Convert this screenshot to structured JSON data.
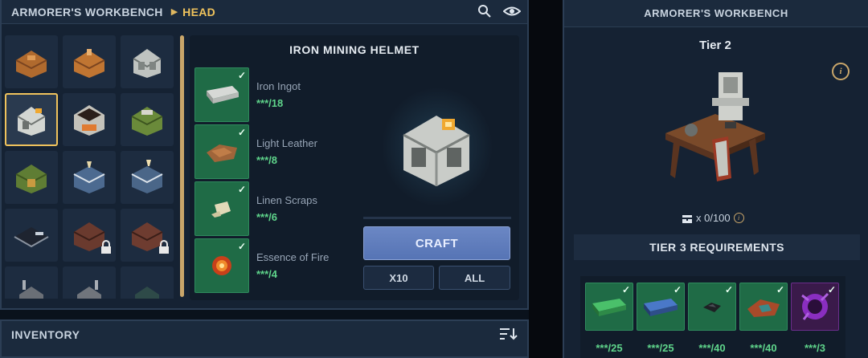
{
  "left": {
    "breadcrumb_root": "ARMORER'S WORKBENCH",
    "breadcrumb_current": "HEAD",
    "icons": [
      "search-icon",
      "eye-icon"
    ]
  },
  "recipe": {
    "title": "IRON MINING HELMET",
    "ingredients": [
      {
        "name": "Iron Ingot",
        "qty": "***/18",
        "icon": "iron-ingot-icon"
      },
      {
        "name": "Light Leather",
        "qty": "***/8",
        "icon": "light-leather-icon"
      },
      {
        "name": "Linen Scraps",
        "qty": "***/6",
        "icon": "linen-scraps-icon"
      },
      {
        "name": "Essence of Fire",
        "qty": "***/4",
        "icon": "essence-of-fire-icon"
      }
    ],
    "craft_label": "CRAFT",
    "x10_label": "X10",
    "all_label": "ALL"
  },
  "inventory": {
    "title": "INVENTORY"
  },
  "right": {
    "title": "ARMORER'S WORKBENCH",
    "tier": "Tier 2",
    "info": "i",
    "chest_count": "x 0/100",
    "requirements_title": "TIER 3 REQUIREMENTS",
    "requirements": [
      {
        "qty": "***/25",
        "icon": "green-bar-icon"
      },
      {
        "qty": "***/25",
        "icon": "blue-bar-icon"
      },
      {
        "qty": "***/40",
        "icon": "dark-shard-icon"
      },
      {
        "qty": "***/40",
        "icon": "copper-leather-icon"
      },
      {
        "qty": "***/3",
        "icon": "void-essence-icon"
      }
    ]
  },
  "colors": {
    "accent_gold": "#f0c35c",
    "ingredient_green": "#1f6b46",
    "qty_green": "#5fd58b",
    "craft_blue": "#5f7ec0"
  }
}
